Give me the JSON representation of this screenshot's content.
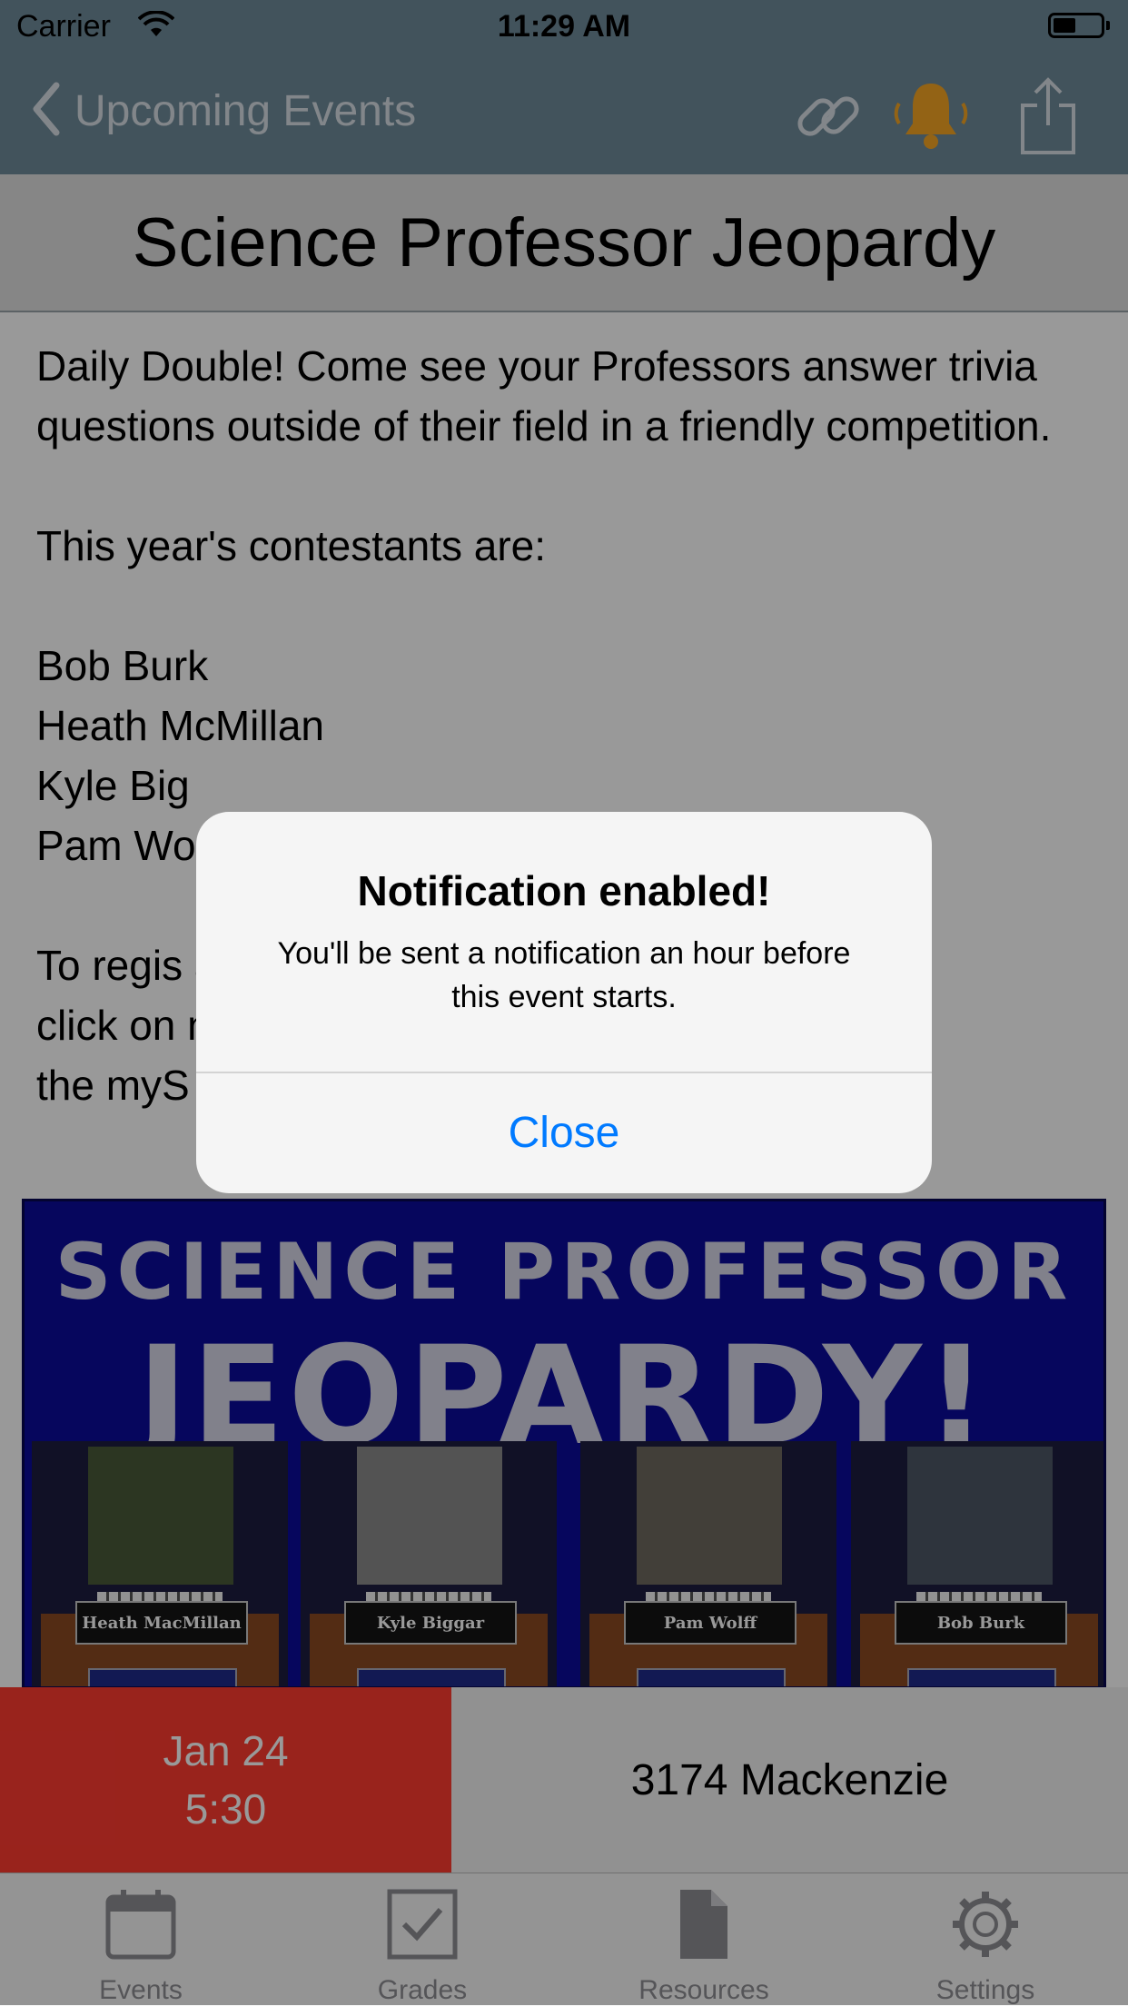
{
  "status_bar": {
    "carrier": "Carrier",
    "time": "11:29 AM",
    "icons": [
      "wifi-icon",
      "battery-icon"
    ]
  },
  "nav": {
    "back_label": "Upcoming Events",
    "icons": [
      "link-icon",
      "bell-icon",
      "share-icon"
    ]
  },
  "event": {
    "title": "Science Professor Jeopardy",
    "paragraphs": [
      "Daily Double! Come see your Professors answer trivia questions outside of their field in a friendly competition.",
      "This year's contestants are:",
      "Bob Burk\nHeath McMillan\nKyle Big\nPam Wo",
      "To regis                                   al and\nclick on                                   nder\nthe myS"
    ]
  },
  "banner": {
    "line1": "SCIENCE PROFESSOR",
    "line2": "JEOPARDY!",
    "contestants": [
      "Heath MacMillan",
      "Kyle Biggar",
      "Pam Wolff",
      "Bob Burk"
    ]
  },
  "info": {
    "date": "Jan 24",
    "time": "5:30",
    "location": "3174 Mackenzie"
  },
  "tabs": [
    {
      "label": "Events",
      "icon": "calendar-icon"
    },
    {
      "label": "Grades",
      "icon": "checkbox-icon"
    },
    {
      "label": "Resources",
      "icon": "document-icon"
    },
    {
      "label": "Settings",
      "icon": "gear-icon"
    }
  ],
  "alert": {
    "title": "Notification enabled!",
    "message": "You'll be sent a notification an hour before this event starts.",
    "button": "Close"
  },
  "colors": {
    "nav": "#6f8a99",
    "date_box": "#ff3b30",
    "banner": "#0a0a9c",
    "alert_button": "#007aff",
    "bell": "#f5a623"
  }
}
